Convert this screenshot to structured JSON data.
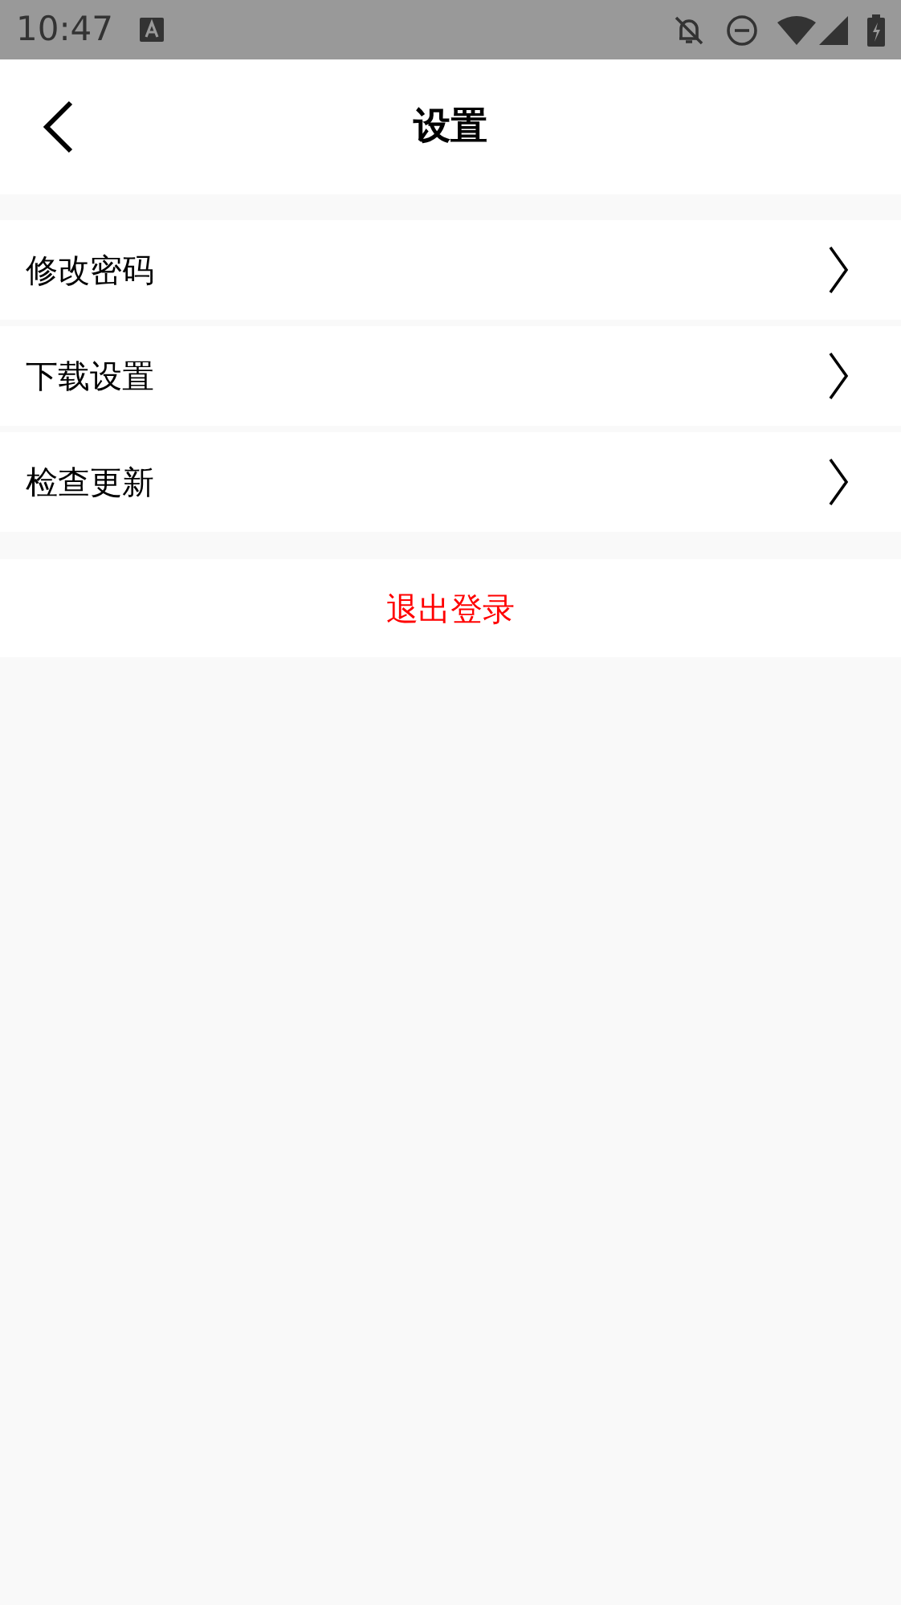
{
  "status_bar": {
    "time": "10:47"
  },
  "header": {
    "title": "设置"
  },
  "menu_items": [
    {
      "label": "修改密码"
    },
    {
      "label": "下载设置"
    },
    {
      "label": "检查更新"
    }
  ],
  "logout_button": {
    "label": "退出登录"
  }
}
